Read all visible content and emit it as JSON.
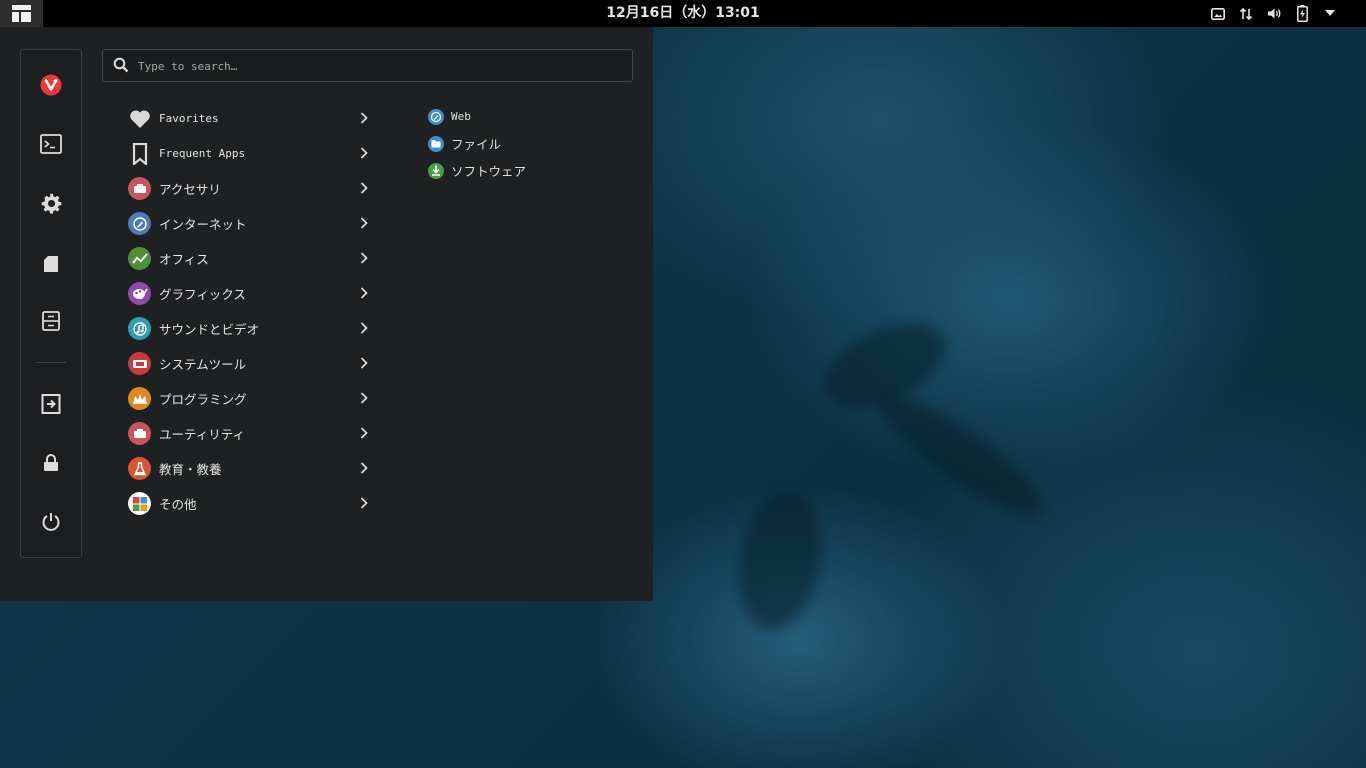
{
  "topbar": {
    "clock": "12月16日（水）13:01",
    "tray": [
      {
        "icon": "screen-share-icon"
      },
      {
        "icon": "network-transfer-icon"
      },
      {
        "icon": "volume-icon"
      },
      {
        "icon": "battery-charging-icon"
      },
      {
        "icon": "system-menu-arrow-icon"
      }
    ]
  },
  "search": {
    "placeholder": "Type to search…"
  },
  "sidebar": {
    "items": [
      {
        "icon": "vivaldi-icon"
      },
      {
        "icon": "terminal-icon"
      },
      {
        "icon": "settings-gear-icon"
      },
      {
        "icon": "documents-icon"
      },
      {
        "icon": "file-cabinet-icon"
      },
      {
        "icon": "logout-icon"
      },
      {
        "icon": "lock-icon"
      },
      {
        "icon": "power-icon"
      }
    ]
  },
  "categories": [
    {
      "label": "Favorites",
      "icon": "heart-icon",
      "color": "#d8d8d8"
    },
    {
      "label": "Frequent Apps",
      "icon": "bookmark-icon",
      "color": "#d8d8d8"
    },
    {
      "label": "アクセサリ",
      "icon": "accessories-icon",
      "color": "#c9545c"
    },
    {
      "label": "インターネット",
      "icon": "internet-icon",
      "color": "#4f79b8"
    },
    {
      "label": "オフィス",
      "icon": "office-icon",
      "color": "#4f8f36"
    },
    {
      "label": "グラフィックス",
      "icon": "graphics-icon",
      "color": "#8d4aa8"
    },
    {
      "label": "サウンドとビデオ",
      "icon": "sound-video-icon",
      "color": "#2f9db3"
    },
    {
      "label": "システムツール",
      "icon": "system-tools-icon",
      "color": "#c83a3a"
    },
    {
      "label": "プログラミング",
      "icon": "programming-icon",
      "color": "#e08a1e"
    },
    {
      "label": "ユーティリティ",
      "icon": "utilities-icon",
      "color": "#c9545c"
    },
    {
      "label": "教育・教養",
      "icon": "education-icon",
      "color": "#d9542f"
    },
    {
      "label": "その他",
      "icon": "other-icon",
      "color": "#ffffff"
    }
  ],
  "apps": [
    {
      "label": "Web",
      "icon": "web-browser-icon",
      "color": "#3f8fc9"
    },
    {
      "label": "ファイル",
      "icon": "files-icon",
      "color": "#3f8fc9"
    },
    {
      "label": "ソフトウェア",
      "icon": "software-icon",
      "color": "#46a046"
    }
  ]
}
